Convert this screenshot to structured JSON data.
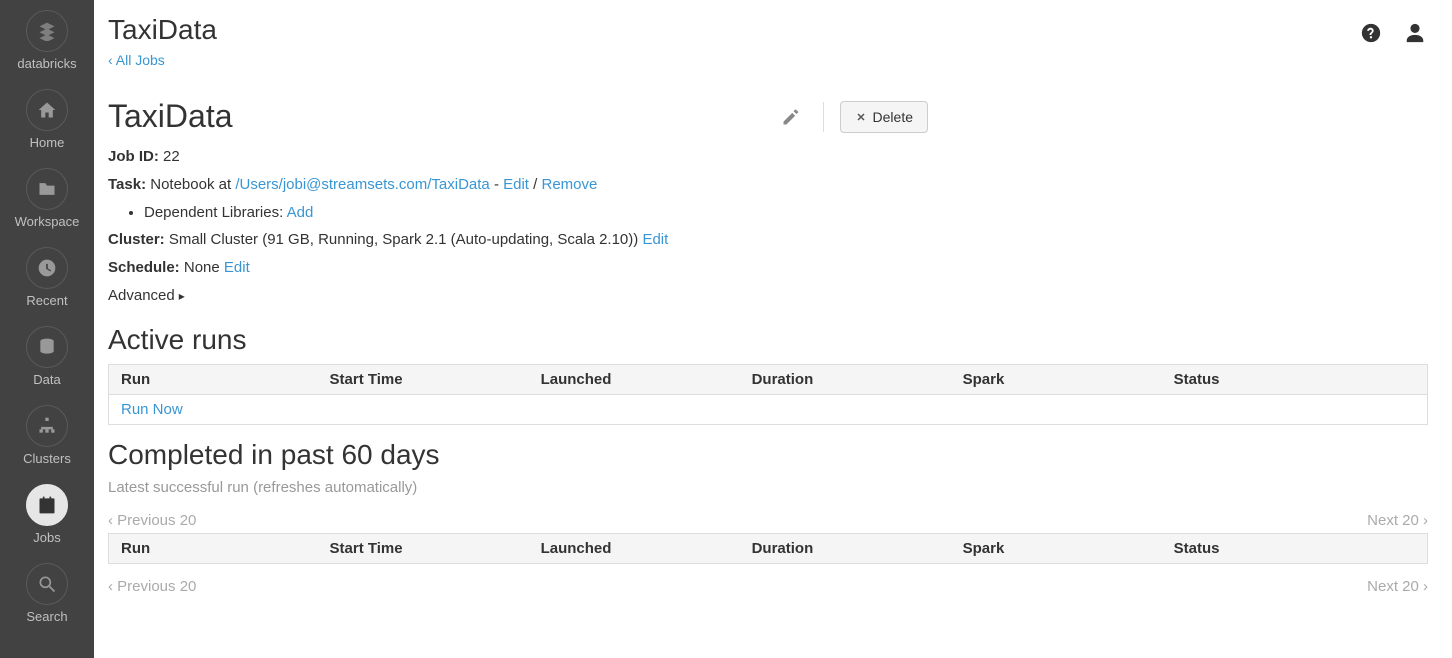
{
  "sidebar": {
    "brand": "databricks",
    "items": [
      {
        "label": "Home",
        "icon": "home"
      },
      {
        "label": "Workspace",
        "icon": "folder"
      },
      {
        "label": "Recent",
        "icon": "clock"
      },
      {
        "label": "Data",
        "icon": "database"
      },
      {
        "label": "Clusters",
        "icon": "sitemap"
      },
      {
        "label": "Jobs",
        "icon": "calendar",
        "active": true
      },
      {
        "label": "Search",
        "icon": "search"
      }
    ]
  },
  "page": {
    "title_top": "TaxiData",
    "all_jobs": "‹ All Jobs",
    "job_title": "TaxiData",
    "delete_label": "Delete"
  },
  "meta": {
    "job_id_label": "Job ID:",
    "job_id_value": "22",
    "task_label": "Task:",
    "task_prefix": "Notebook at ",
    "task_path": "/Users/jobi@streamsets.com/TaxiData",
    "task_edit": "Edit",
    "task_remove": "Remove",
    "dep_label": "Dependent Libraries: ",
    "dep_add": "Add",
    "cluster_label": "Cluster:",
    "cluster_value": "Small Cluster (91 GB, Running, Spark 2.1 (Auto-updating, Scala 2.10))",
    "cluster_edit": "Edit",
    "schedule_label": "Schedule:",
    "schedule_value": "None",
    "schedule_edit": "Edit",
    "advanced": "Advanced"
  },
  "active_runs": {
    "heading": "Active runs",
    "columns": [
      "Run",
      "Start Time",
      "Launched",
      "Duration",
      "Spark",
      "Status"
    ],
    "run_now": "Run Now"
  },
  "completed": {
    "heading": "Completed in past 60 days",
    "note": "Latest successful run (refreshes automatically)",
    "columns": [
      "Run",
      "Start Time",
      "Launched",
      "Duration",
      "Spark",
      "Status"
    ],
    "prev": "‹ Previous 20",
    "next": "Next 20 ›"
  }
}
